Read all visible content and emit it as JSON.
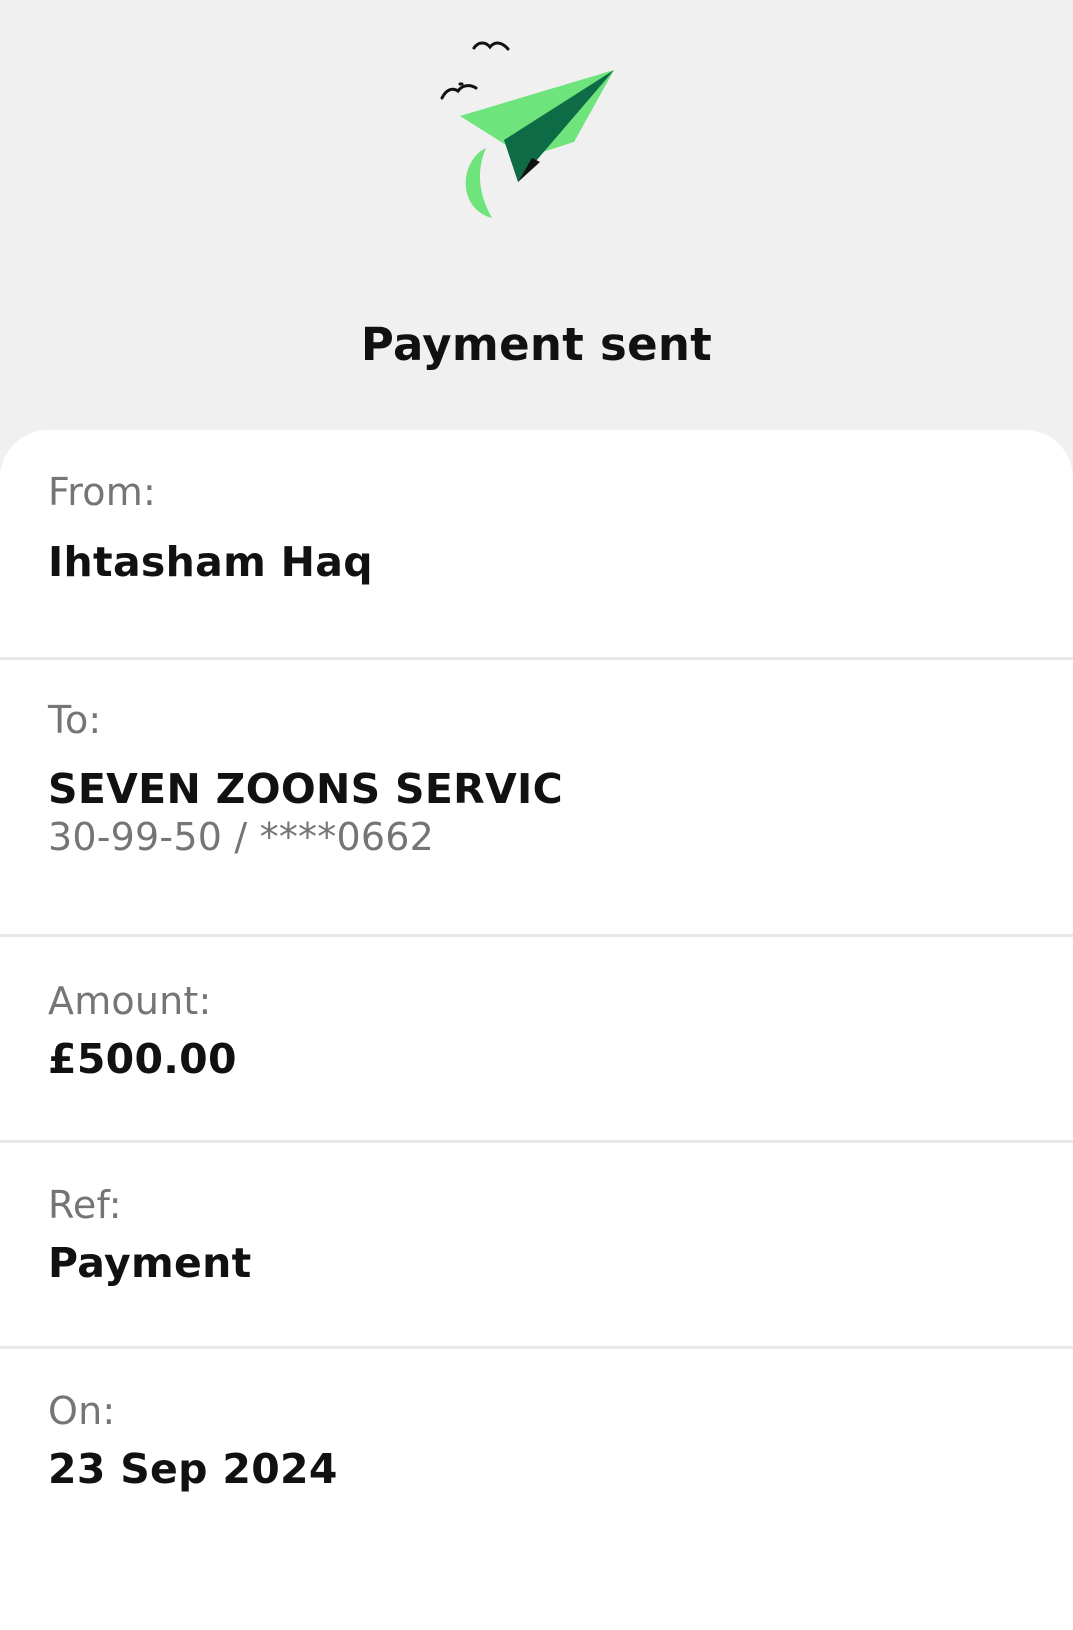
{
  "header": {
    "icon": "paper-plane-birds-icon",
    "title": "Payment sent"
  },
  "details": {
    "from": {
      "label": "From:",
      "value": "Ihtasham Haq"
    },
    "to": {
      "label": "To:",
      "value": "SEVEN ZOONS SERVIC",
      "account": "30-99-50 / ****0662"
    },
    "amount": {
      "label": "Amount:",
      "value": "£500.00"
    },
    "reference": {
      "label": "Ref:",
      "value": "Payment"
    },
    "date": {
      "label": "On:",
      "value": "23 Sep 2024"
    }
  },
  "colors": {
    "background": "#f0f0f0",
    "card": "#ffffff",
    "plane_light": "#6fe37c",
    "plane_dark": "#0d6b45",
    "text_primary": "#111111",
    "text_secondary": "#757575",
    "divider": "#e8e8e8"
  }
}
